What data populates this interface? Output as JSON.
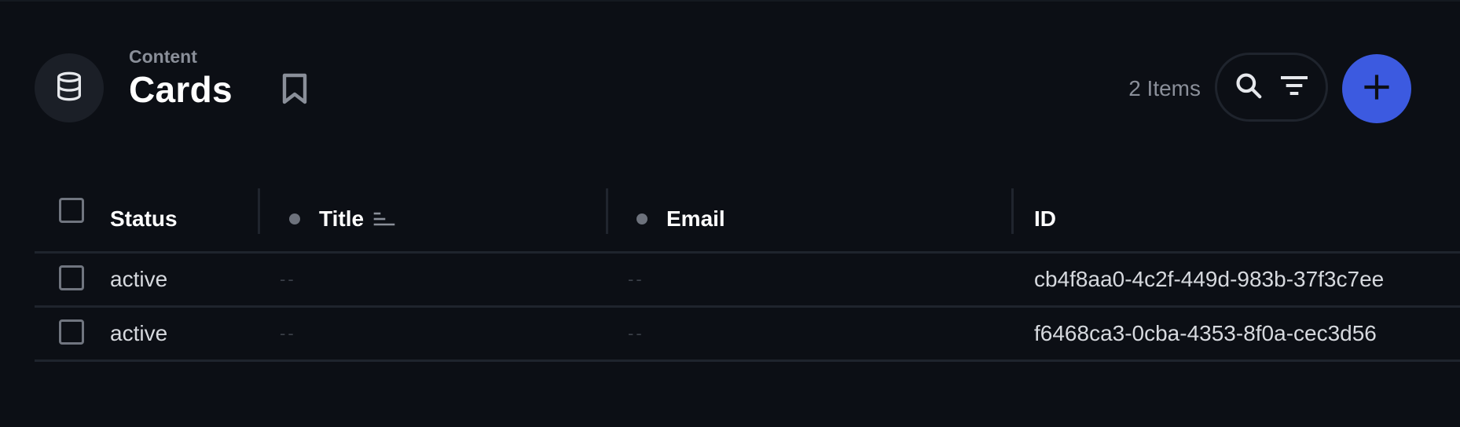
{
  "header": {
    "breadcrumb": "Content",
    "title": "Cards",
    "items_count": "2 Items",
    "icons": {
      "collection": "database-icon",
      "bookmark": "bookmark-icon",
      "search": "search-icon",
      "filter": "filter-icon",
      "add": "plus-icon"
    },
    "accent_color": "#3c5ae0"
  },
  "table": {
    "columns": [
      {
        "label": "Status"
      },
      {
        "label": "Title"
      },
      {
        "label": "Email"
      },
      {
        "label": "ID"
      }
    ],
    "rows": [
      {
        "status": "active",
        "title": "--",
        "email": "--",
        "id": "cb4f8aa0-4c2f-449d-983b-37f3c7ee"
      },
      {
        "status": "active",
        "title": "--",
        "email": "--",
        "id": "f6468ca3-0cba-4353-8f0a-cec3d56"
      }
    ]
  }
}
